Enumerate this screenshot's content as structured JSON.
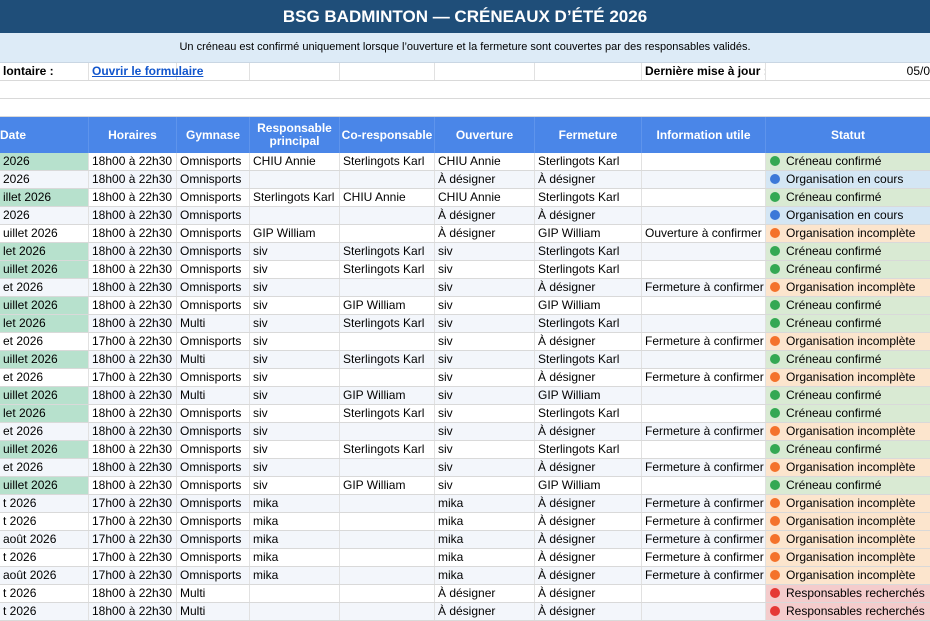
{
  "title": "BSG BADMINTON — CRÉNEAUX D’ÉTÉ 2026",
  "subtitle": "Un créneau est confirmé uniquement lorsque l’ouverture et la fermeture sont couvertes par des responsables validés.",
  "info": {
    "volunteer_label": "lontaire :",
    "form_link": "Ouvrir le formulaire",
    "last_update_label": "Dernière mise à jour :",
    "last_update_value": "05/0"
  },
  "headers": [
    "Date",
    "Horaires",
    "Gymnase",
    "Responsable principal",
    "Co-responsable",
    "Ouverture",
    "Fermeture",
    "Information utile",
    "Statut"
  ],
  "status_colors": {
    "confirmed": "#34a853",
    "in_progress": "#3c78d8",
    "incomplete": "#f4722b",
    "searching": "#e53935"
  },
  "rows": [
    {
      "date": " 2026",
      "dg": true,
      "time": "18h00 à 22h30",
      "gym": "Omnisports",
      "resp": "CHIU Annie",
      "co": "Sterlingots Karl",
      "open": "CHIU Annie",
      "close": "Sterlingots Karl",
      "info": "",
      "status": "Créneau confirmé",
      "s": "g"
    },
    {
      "date": " 2026",
      "dg": false,
      "time": "18h00 à 22h30",
      "gym": "Omnisports",
      "resp": "",
      "co": "",
      "open": "À désigner",
      "close": "À désigner",
      "info": "",
      "status": "Organisation en cours",
      "s": "b"
    },
    {
      "date": "illet 2026",
      "dg": true,
      "time": "18h00 à 22h30",
      "gym": "Omnisports",
      "resp": "Sterlingots Karl",
      "co": "CHIU Annie",
      "open": "CHIU Annie",
      "close": "Sterlingots Karl",
      "info": "",
      "status": "Créneau confirmé",
      "s": "g"
    },
    {
      "date": " 2026",
      "dg": false,
      "time": "18h00 à 22h30",
      "gym": "Omnisports",
      "resp": "",
      "co": "",
      "open": "À désigner",
      "close": "À désigner",
      "info": "",
      "status": "Organisation en cours",
      "s": "b"
    },
    {
      "date": "uillet 2026",
      "dg": false,
      "time": "18h00 à 22h30",
      "gym": "Omnisports",
      "resp": "GIP William",
      "co": "",
      "open": "À désigner",
      "close": "GIP William",
      "info": "Ouverture à confirmer",
      "status": "Organisation incomplète",
      "s": "o"
    },
    {
      "date": "let 2026",
      "dg": true,
      "time": "18h00 à 22h30",
      "gym": "Omnisports",
      "resp": "siv",
      "co": "Sterlingots Karl",
      "open": "siv",
      "close": "Sterlingots Karl",
      "info": "",
      "status": "Créneau confirmé",
      "s": "g"
    },
    {
      "date": "uillet 2026",
      "dg": true,
      "time": "18h00 à 22h30",
      "gym": "Omnisports",
      "resp": "siv",
      "co": "Sterlingots Karl",
      "open": "siv",
      "close": "Sterlingots Karl",
      "info": "",
      "status": "Créneau confirmé",
      "s": "g"
    },
    {
      "date": "et 2026",
      "dg": false,
      "time": "18h00 à 22h30",
      "gym": "Omnisports",
      "resp": "siv",
      "co": "",
      "open": "siv",
      "close": "À désigner",
      "info": "Fermeture à confirmer",
      "status": "Organisation incomplète",
      "s": "o"
    },
    {
      "date": "uillet 2026",
      "dg": true,
      "time": "18h00 à 22h30",
      "gym": "Omnisports",
      "resp": "siv",
      "co": "GIP William",
      "open": "siv",
      "close": "GIP William",
      "info": "",
      "status": "Créneau confirmé",
      "s": "g"
    },
    {
      "date": "let 2026",
      "dg": true,
      "time": "18h00 à 22h30",
      "gym": "Multi",
      "resp": "siv",
      "co": "Sterlingots Karl",
      "open": "siv",
      "close": "Sterlingots Karl",
      "info": "",
      "status": "Créneau confirmé",
      "s": "g"
    },
    {
      "date": "et 2026",
      "dg": false,
      "time": "17h00 à 22h30",
      "gym": "Omnisports",
      "resp": "siv",
      "co": "",
      "open": "siv",
      "close": "À désigner",
      "info": "Fermeture à confirmer",
      "status": "Organisation incomplète",
      "s": "o"
    },
    {
      "date": "uillet 2026",
      "dg": true,
      "time": "18h00 à 22h30",
      "gym": "Multi",
      "resp": "siv",
      "co": "Sterlingots Karl",
      "open": "siv",
      "close": "Sterlingots Karl",
      "info": "",
      "status": "Créneau confirmé",
      "s": "g"
    },
    {
      "date": "et 2026",
      "dg": false,
      "time": "17h00 à 22h30",
      "gym": "Omnisports",
      "resp": "siv",
      "co": "",
      "open": "siv",
      "close": "À désigner",
      "info": "Fermeture à confirmer",
      "status": "Organisation incomplète",
      "s": "o"
    },
    {
      "date": "uillet 2026",
      "dg": true,
      "time": "18h00 à 22h30",
      "gym": "Multi",
      "resp": "siv",
      "co": "GIP William",
      "open": "siv",
      "close": "GIP William",
      "info": "",
      "status": "Créneau confirmé",
      "s": "g"
    },
    {
      "date": "let 2026",
      "dg": true,
      "time": "18h00 à 22h30",
      "gym": "Omnisports",
      "resp": "siv",
      "co": "Sterlingots Karl",
      "open": "siv",
      "close": "Sterlingots Karl",
      "info": "",
      "status": "Créneau confirmé",
      "s": "g"
    },
    {
      "date": "et 2026",
      "dg": false,
      "time": "18h00 à 22h30",
      "gym": "Omnisports",
      "resp": "siv",
      "co": "",
      "open": "siv",
      "close": "À désigner",
      "info": "Fermeture à confirmer",
      "status": "Organisation incomplète",
      "s": "o"
    },
    {
      "date": "uillet 2026",
      "dg": true,
      "time": "18h00 à 22h30",
      "gym": "Omnisports",
      "resp": "siv",
      "co": "Sterlingots Karl",
      "open": "siv",
      "close": "Sterlingots Karl",
      "info": "",
      "status": "Créneau confirmé",
      "s": "g"
    },
    {
      "date": "et 2026",
      "dg": false,
      "time": "18h00 à 22h30",
      "gym": "Omnisports",
      "resp": "siv",
      "co": "",
      "open": "siv",
      "close": "À désigner",
      "info": "Fermeture à confirmer",
      "status": "Organisation incomplète",
      "s": "o"
    },
    {
      "date": "uillet 2026",
      "dg": true,
      "time": "18h00 à 22h30",
      "gym": "Omnisports",
      "resp": "siv",
      "co": "GIP William",
      "open": "siv",
      "close": "GIP William",
      "info": "",
      "status": "Créneau confirmé",
      "s": "g"
    },
    {
      "date": "t 2026",
      "dg": false,
      "time": "17h00 à 22h30",
      "gym": "Omnisports",
      "resp": "mika",
      "co": "",
      "open": "mika",
      "close": "À désigner",
      "info": "Fermeture à confirmer",
      "status": "Organisation incomplète",
      "s": "o"
    },
    {
      "date": "t 2026",
      "dg": false,
      "time": "17h00 à 22h30",
      "gym": "Omnisports",
      "resp": "mika",
      "co": "",
      "open": "mika",
      "close": "À désigner",
      "info": "Fermeture à confirmer",
      "status": "Organisation incomplète",
      "s": "o"
    },
    {
      "date": "août 2026",
      "dg": false,
      "time": "17h00 à 22h30",
      "gym": "Omnisports",
      "resp": "mika",
      "co": "",
      "open": "mika",
      "close": "À désigner",
      "info": "Fermeture à confirmer",
      "status": "Organisation incomplète",
      "s": "o"
    },
    {
      "date": "t 2026",
      "dg": false,
      "time": "17h00 à 22h30",
      "gym": "Omnisports",
      "resp": "mika",
      "co": "",
      "open": "mika",
      "close": "À désigner",
      "info": "Fermeture à confirmer",
      "status": "Organisation incomplète",
      "s": "o"
    },
    {
      "date": "août 2026",
      "dg": false,
      "time": "17h00 à 22h30",
      "gym": "Omnisports",
      "resp": "mika",
      "co": "",
      "open": "mika",
      "close": "À désigner",
      "info": "Fermeture à confirmer",
      "status": "Organisation incomplète",
      "s": "o"
    },
    {
      "date": "t 2026",
      "dg": false,
      "time": "18h00 à 22h30",
      "gym": "Multi",
      "resp": "",
      "co": "",
      "open": "À désigner",
      "close": "À désigner",
      "info": "",
      "status": "Responsables recherchés",
      "s": "r"
    },
    {
      "date": "t 2026",
      "dg": false,
      "time": "18h00 à 22h30",
      "gym": "Multi",
      "resp": "",
      "co": "",
      "open": "À désigner",
      "close": "À désigner",
      "info": "",
      "status": "Responsables recherchés",
      "s": "r"
    }
  ]
}
